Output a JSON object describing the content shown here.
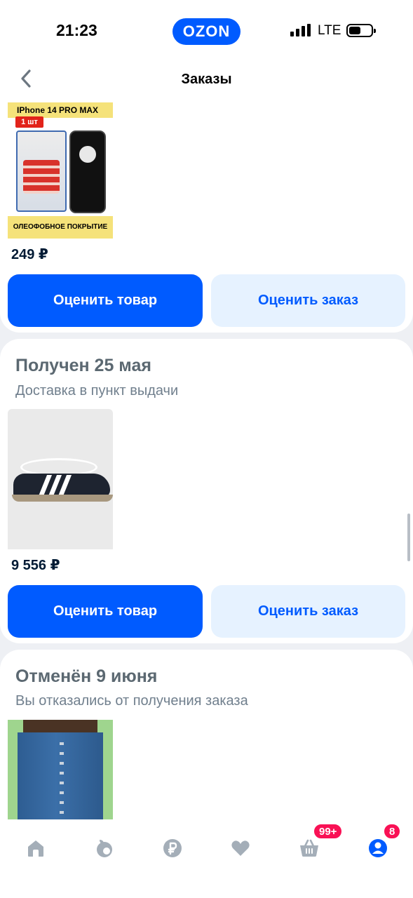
{
  "status_bar": {
    "time": "21:23",
    "brand": "OZON",
    "network": "LTE"
  },
  "header": {
    "title": "Заказы"
  },
  "orders": [
    {
      "product": {
        "image_label_top": "IPhone 14 PRO MAX",
        "image_badge": "1 шт",
        "image_label_bottom": "ОЛЕОФОБНОЕ ПОКРЫТИЕ",
        "price": "249 ₽"
      },
      "rate_product_label": "Оценить товар",
      "rate_order_label": "Оценить заказ"
    },
    {
      "status": "Получен 25 мая",
      "delivery": "Доставка в пункт выдачи",
      "product": {
        "price": "9 556 ₽"
      },
      "rate_product_label": "Оценить товар",
      "rate_order_label": "Оценить заказ"
    },
    {
      "status": "Отменён 9 июня",
      "delivery": "Вы отказались от получения заказа"
    }
  ],
  "tab_bar": {
    "items": [
      {
        "icon": "home-icon"
      },
      {
        "icon": "fresh-apple-icon"
      },
      {
        "icon": "ruble-finance-icon"
      },
      {
        "icon": "heart-icon"
      },
      {
        "icon": "cart-icon",
        "badge": "99+"
      },
      {
        "icon": "profile-icon",
        "badge": "8"
      }
    ]
  },
  "colors": {
    "accent": "#005bff",
    "secondary_button": "#e6f2ff",
    "badge": "#f91155",
    "background": "#eef0f4"
  }
}
